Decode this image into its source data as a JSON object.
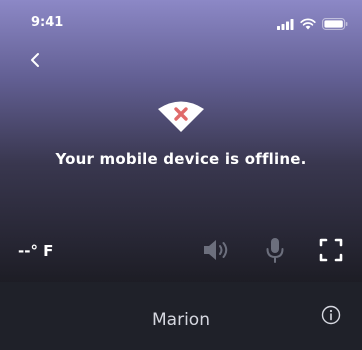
{
  "status_bar": {
    "time": "9:41"
  },
  "offline": {
    "message": "Your mobile device is offline.",
    "icon": "wifi-off-icon",
    "accent": "#e06a6a"
  },
  "controls": {
    "temperature": "--° F",
    "speaker": "speaker-icon",
    "microphone": "microphone-icon",
    "fullscreen": "fullscreen-icon"
  },
  "device": {
    "name": "Marion",
    "info": "info-icon"
  }
}
